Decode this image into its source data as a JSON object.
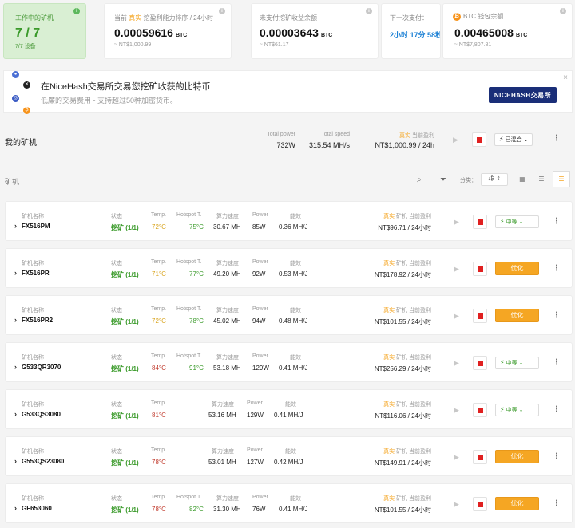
{
  "stats": {
    "active": {
      "label": "工作中的矿机",
      "value": "7 / 7",
      "sub": "7/7 设备"
    },
    "profitability": {
      "label_prefix": "当前",
      "label_tag": "真实",
      "label_rest": "挖盈利能力排序 / 24小时",
      "value": "0.00059616",
      "unit": "BTC",
      "sub": "≈ NT$1,000.99"
    },
    "unpaid": {
      "label": "未支付挖矿收益余额",
      "value": "0.00003643",
      "unit": "BTC",
      "sub": "≈ NT$61.17"
    },
    "next_payout": {
      "label": "下一次支付：",
      "value": "2小时 17分 58秒"
    },
    "balance": {
      "label": "BTC 钱包余额",
      "value": "0.00465008",
      "unit": "BTC",
      "sub": "≈ NT$7,807.81"
    }
  },
  "banner": {
    "title": "在NiceHash交易所交易您挖矿收获的比特币",
    "desc": "低廉的交易费用 - 支持超过50种加密货币。",
    "cta": "NICEHASH交易所",
    "close": "×"
  },
  "summary": {
    "title": "我的矿机",
    "total_power_label": "Total power",
    "total_power": "732W",
    "total_speed_label": "Total speed",
    "total_speed": "315.54 MH/s",
    "profit_tag": "真实",
    "profit_label": "当前盈利",
    "profit": "NT$1,000.99 / 24h",
    "mode": "已混合"
  },
  "toolbar": {
    "title": "矿机",
    "sort_label": "分类：",
    "sort_value": "↓₿ ⇕"
  },
  "columns": {
    "name": "矿机名称",
    "state": "状态",
    "temp": "Temp.",
    "hotspot": "Hotspot T.",
    "speed": "算力速度",
    "power": "Power",
    "eff": "能效",
    "profit_tag": "真实",
    "profit_mid": "矿机",
    "profit_rest": "当前盈利"
  },
  "rows": [
    {
      "name": "FX516PM",
      "state": "挖矿 (1/1)",
      "temp": "72°C",
      "hotspot": "75°C",
      "speed": "30.67 MH",
      "power": "85W",
      "eff": "0.36 MH/J",
      "profit": "NT$96.71 / 24小时",
      "action": "中等"
    },
    {
      "name": "FX516PR",
      "state": "挖矿 (1/1)",
      "temp": "71°C",
      "hotspot": "77°C",
      "speed": "49.20 MH",
      "power": "92W",
      "eff": "0.53 MH/J",
      "profit": "NT$178.92 / 24小时",
      "action": "优化"
    },
    {
      "name": "FX516PR2",
      "state": "挖矿 (1/1)",
      "temp": "72°C",
      "hotspot": "78°C",
      "speed": "45.02 MH",
      "power": "94W",
      "eff": "0.48 MH/J",
      "profit": "NT$101.55 / 24小时",
      "action": "优化"
    },
    {
      "name": "G533QR3070",
      "state": "挖矿 (1/1)",
      "temp": "84°C",
      "hotspot": "91°C",
      "speed": "53.18 MH",
      "power": "129W",
      "eff": "0.41 MH/J",
      "profit": "NT$256.29 / 24小时",
      "action": "中等"
    },
    {
      "name": "G533QS3080",
      "state": "挖矿 (1/1)",
      "temp": "81°C",
      "speed": "53.16 MH",
      "power": "129W",
      "eff": "0.41 MH/J",
      "profit": "NT$116.06 / 24小时",
      "action": "中等"
    },
    {
      "name": "G553QS23080",
      "state": "挖矿 (1/1)",
      "temp": "78°C",
      "speed": "53.01 MH",
      "power": "127W",
      "eff": "0.42 MH/J",
      "profit": "NT$149.91 / 24小时",
      "action": "优化"
    },
    {
      "name": "GF653060",
      "state": "挖矿 (1/1)",
      "temp": "78°C",
      "hotspot": "82°C",
      "speed": "31.30 MH",
      "power": "76W",
      "eff": "0.41 MH/J",
      "profit": "NT$101.55 / 24小时",
      "action": "优化"
    }
  ],
  "colors": {
    "accent": "#f5a623",
    "green": "#3a9a2a",
    "stop": "#e02020",
    "banner_button": "#1a2e78"
  },
  "icons": {
    "info": "info-icon",
    "bitcoin": "bitcoin-icon",
    "search": "search-icon",
    "filter": "filter-icon",
    "bolt": "bolt-icon"
  }
}
